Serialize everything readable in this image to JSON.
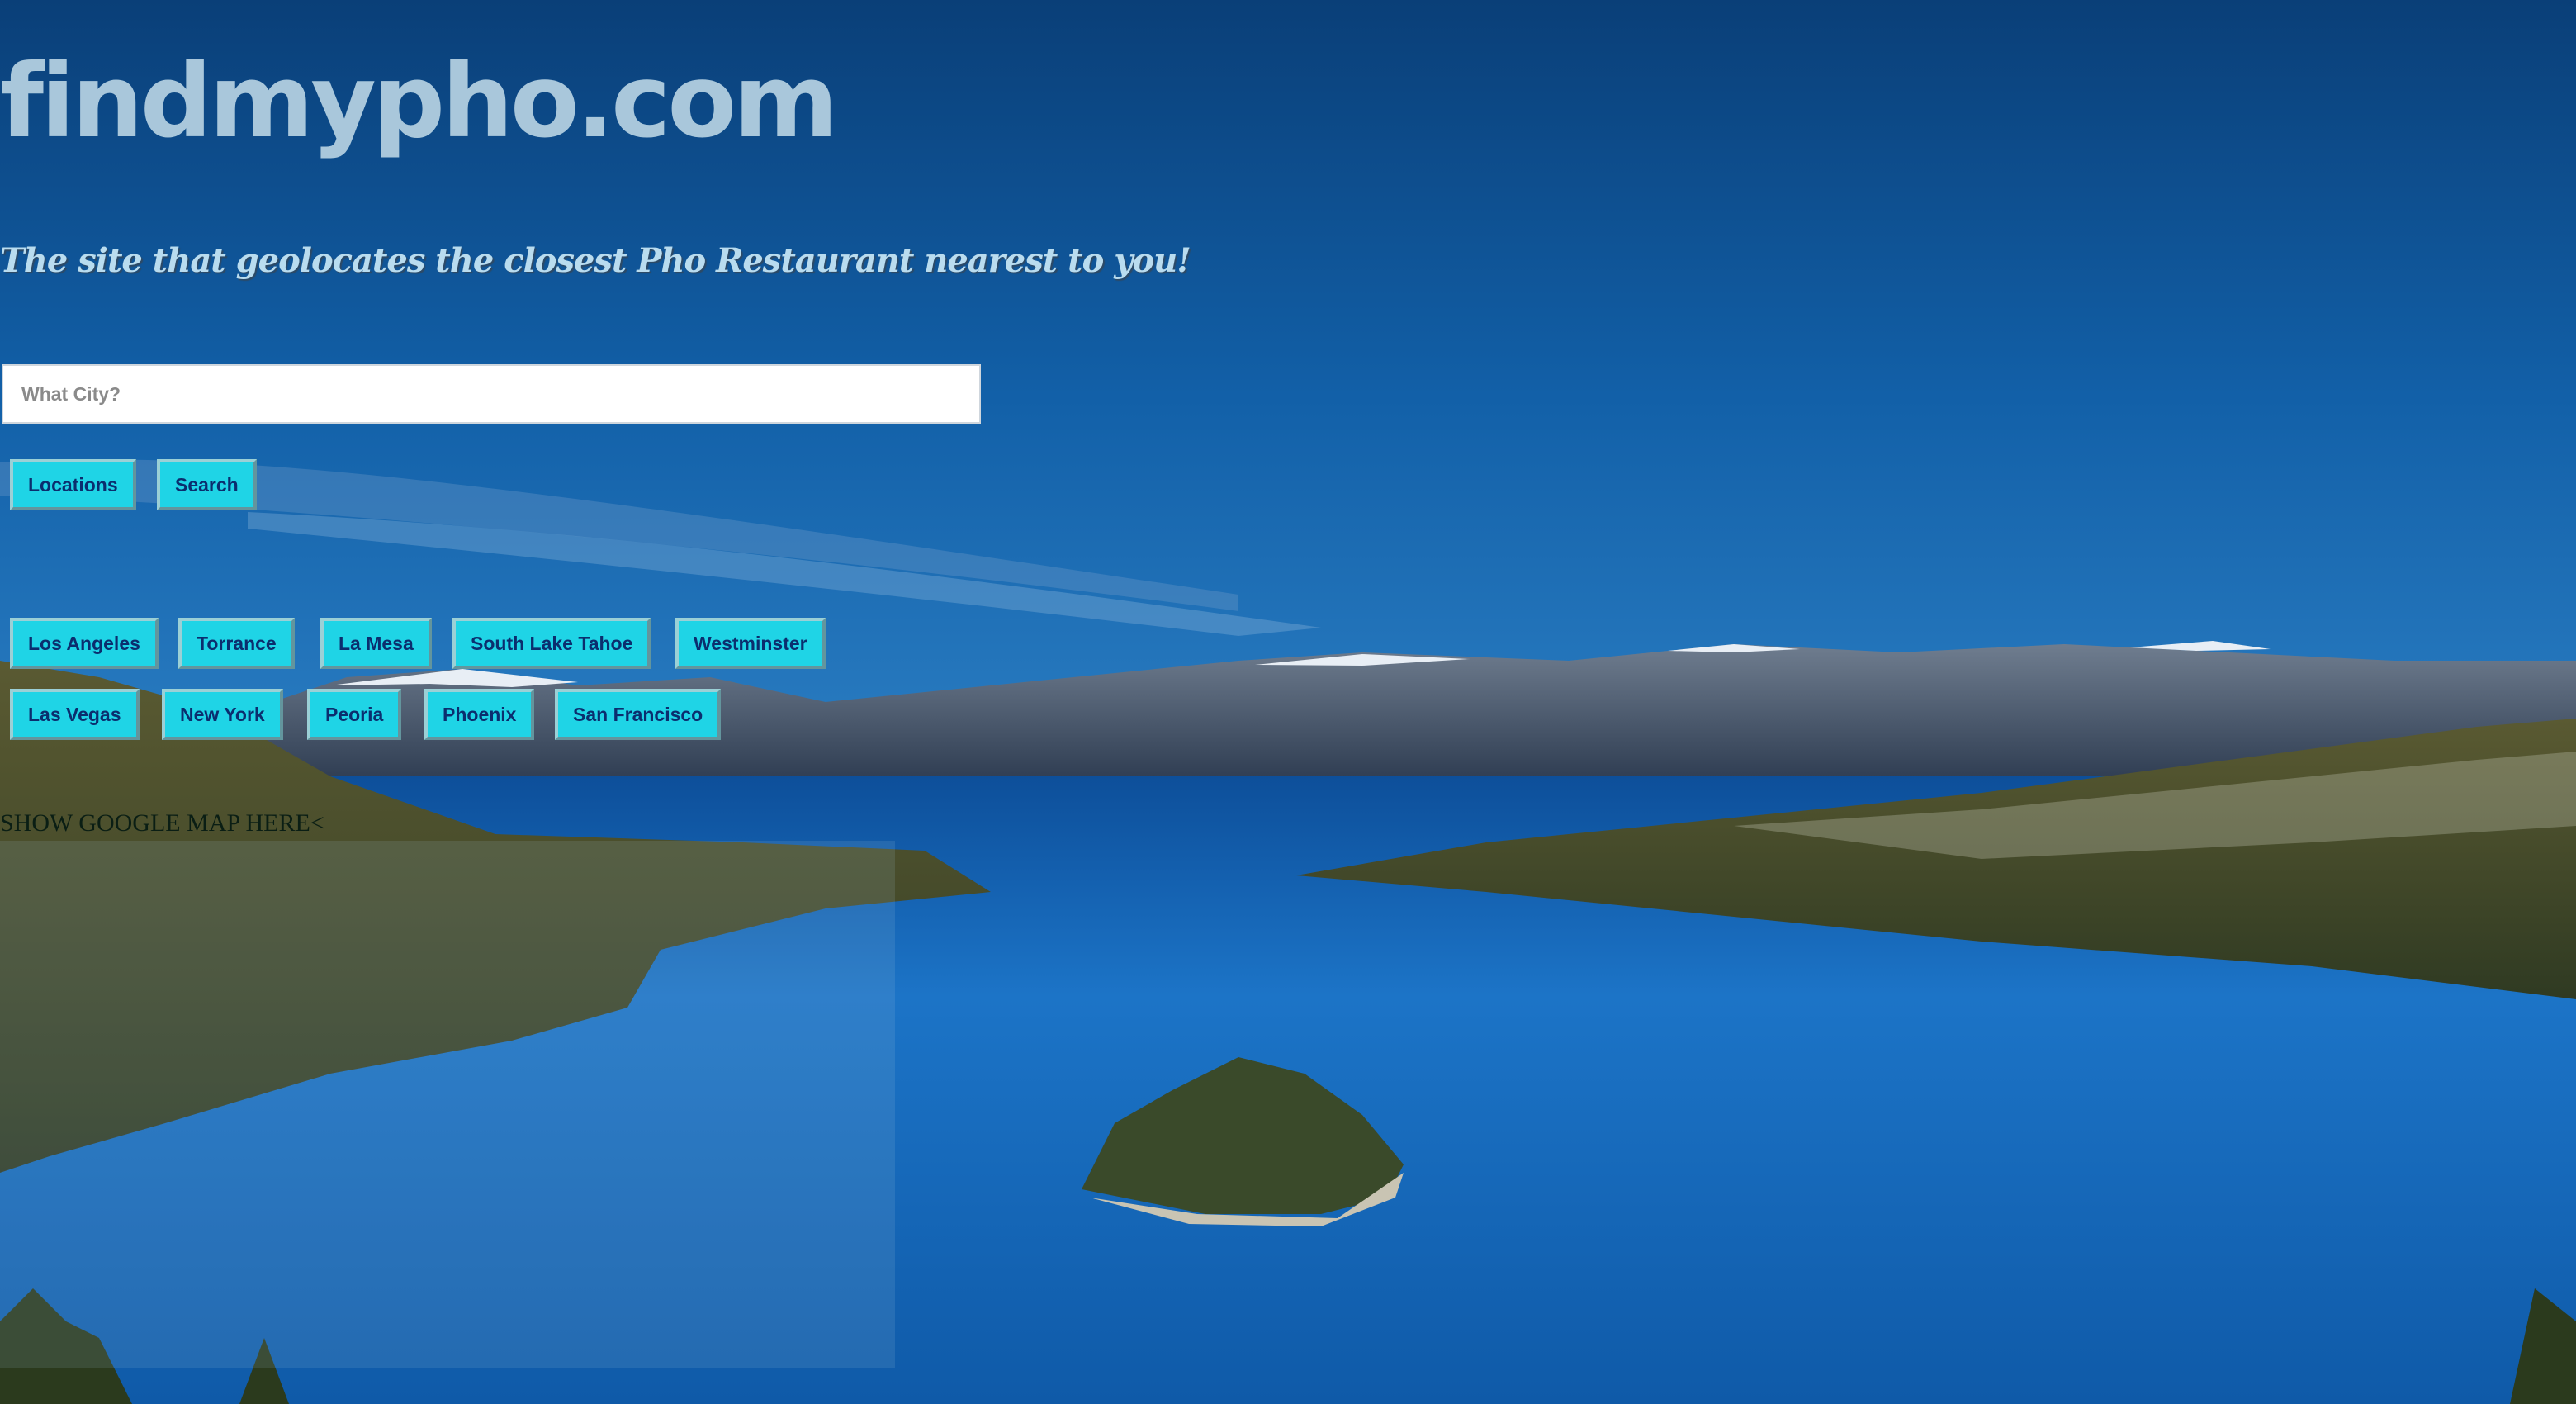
{
  "site": {
    "title": "findmypho.com",
    "tagline": "The site that geolocates the closest Pho Restaurant nearest to you!"
  },
  "search": {
    "placeholder": "What City?",
    "value": ""
  },
  "actions": {
    "locations_label": "Locations",
    "search_label": "Search"
  },
  "cities": {
    "row1": [
      "Los Angeles",
      "Torrance",
      "La Mesa",
      "South Lake Tahoe",
      "Westminster"
    ],
    "row2": [
      "Las Vegas",
      "New York",
      "Peoria",
      "Phoenix",
      "San Francisco"
    ]
  },
  "map": {
    "placeholder_text": "SHOW GOOGLE MAP HERE<"
  },
  "colors": {
    "button_bg": "#1fd4e6",
    "button_text": "#0b2e6e",
    "title": "#a9c7db",
    "sky": "#0d4e8f",
    "lake": "#1a6fc0"
  },
  "background": {
    "icon": "lake-landscape-photo"
  }
}
